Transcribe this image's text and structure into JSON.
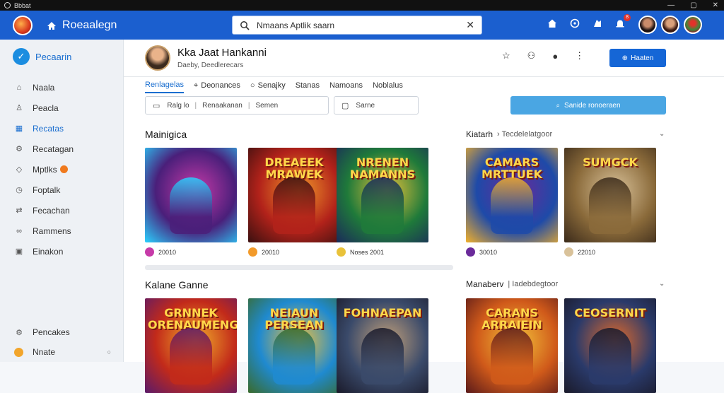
{
  "os": {
    "title": "Bbbat"
  },
  "header": {
    "app_name": "Roeaalegn",
    "search": {
      "value": "Nmaans Aptlik saarn",
      "placeholder": ""
    },
    "notification_count": "8",
    "accent": "#1b5fcf"
  },
  "sidebar": {
    "brand": "Pecaarin",
    "items": [
      {
        "label": "Naala",
        "icon": "home-icon"
      },
      {
        "label": "Peacla",
        "icon": "user-icon"
      },
      {
        "label": "Recatas",
        "icon": "grid-icon",
        "active": true
      },
      {
        "label": "Recatagan",
        "icon": "gear-icon"
      },
      {
        "label": "Mptlks",
        "icon": "tag-icon",
        "badge": true
      },
      {
        "label": "Foptalk",
        "icon": "clock-icon"
      },
      {
        "label": "Fecachan",
        "icon": "share-icon"
      },
      {
        "label": "Rammens",
        "icon": "link-icon"
      },
      {
        "label": "Einakon",
        "icon": "square-icon"
      }
    ],
    "bottom": [
      {
        "label": "Pencakes",
        "icon": "gear-icon"
      },
      {
        "label": "Nnate",
        "icon": "coin-icon"
      }
    ]
  },
  "profile": {
    "name": "Kka Jaat Hankanni",
    "subtitle": "Daeby, Deedlerecars"
  },
  "toolbar": {
    "primary_label": "Haaten"
  },
  "tabs": [
    {
      "label": "Renlagelas",
      "active": true
    },
    {
      "label": "Deonances",
      "icon": "pin-icon"
    },
    {
      "label": "Senajky",
      "icon": "circle-icon"
    },
    {
      "label": "Stanas"
    },
    {
      "label": "Namoans"
    },
    {
      "label": "Noblalus"
    }
  ],
  "filters": {
    "filter1": {
      "part1": "Ralg lo",
      "part2": "Renaakanan",
      "part3": "Semen"
    },
    "filter2": {
      "label": "Sarne"
    },
    "search_button": "Sanide ronoeraen"
  },
  "sections": [
    {
      "title": "Mainigica",
      "aside_title": "Kiatarh",
      "aside_sub": "Tecdelelatgoor",
      "cards": [
        {
          "title": "",
          "meta": "20010",
          "colors": [
            "#4a1f7a",
            "#c63aa8",
            "#2ad1ff"
          ]
        },
        {
          "title": "DREAEEK MRAWEK",
          "meta": "20010",
          "colors": [
            "#b2221a",
            "#f29a2a",
            "#3a1010"
          ]
        },
        {
          "title": "NRENEN NAMANNS",
          "meta": "Noses 2001",
          "colors": [
            "#1f7a3a",
            "#e9c23a",
            "#1a2a5a"
          ]
        },
        {
          "title": "CAMARS MRTTUEK",
          "meta": "30010",
          "colors": [
            "#1e4aa8",
            "#6a2a9a",
            "#f2b02a"
          ]
        },
        {
          "title": "SUMGCK",
          "meta": "22010",
          "colors": [
            "#8a6a3a",
            "#d9c29a",
            "#3a2a1a"
          ]
        }
      ]
    },
    {
      "title": "Kalane Ganne",
      "aside_title": "Manaberv",
      "aside_sub": "Iadebdegtoor",
      "cards": [
        {
          "title": "GRNNEK ORENAUMENG",
          "meta": "",
          "colors": [
            "#c22a1a",
            "#f2b02a",
            "#5a1a6a"
          ]
        },
        {
          "title": "NEIAUN PERSEAN",
          "meta": "",
          "colors": [
            "#1f8ad0",
            "#f2c23a",
            "#3a6a2a"
          ]
        },
        {
          "title": "FOHNAEPAN",
          "meta": "",
          "colors": [
            "#3a4a6a",
            "#c2a07a",
            "#1a1a2a"
          ]
        },
        {
          "title": "CARANS ARRAIEIN",
          "meta": "",
          "colors": [
            "#d05a1a",
            "#f2c23a",
            "#5a1a1a"
          ]
        },
        {
          "title": "CEOSERNIT",
          "meta": "",
          "colors": [
            "#2a3a6a",
            "#e26a2a",
            "#1a1a2a"
          ]
        }
      ]
    }
  ]
}
